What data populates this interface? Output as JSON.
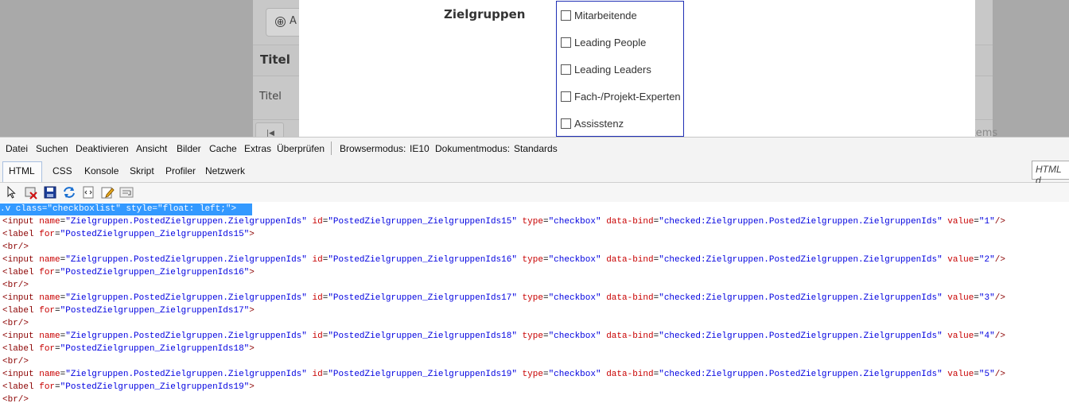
{
  "background": {
    "add_button_label": "A",
    "add_icon": "⊕",
    "table_header_title": "Titel",
    "row_title": "Titel",
    "pager_icon": "|◀",
    "items_label": "items"
  },
  "form": {
    "field_label": "Zielgruppen",
    "options": [
      {
        "label": "Mitarbeitende",
        "checked": false
      },
      {
        "label": "Leading People",
        "checked": false
      },
      {
        "label": "Leading Leaders",
        "checked": false
      },
      {
        "label": "Fach-/Projekt-Experten",
        "checked": false
      },
      {
        "label": "Assisstenz",
        "checked": false
      }
    ]
  },
  "devtools": {
    "menu": [
      "Datei",
      "Suchen",
      "Deaktivieren",
      "Ansicht",
      "Bilder",
      "Cache",
      "Extras",
      "Überprüfen"
    ],
    "browser_mode_label": "Browsermodus:",
    "browser_mode_value": "IE10",
    "document_mode_label": "Dokumentmodus:",
    "document_mode_value": "Standards",
    "tabs": [
      "HTML",
      "CSS",
      "Konsole",
      "Skript",
      "Profiler",
      "Netzwerk"
    ],
    "active_tab": "HTML",
    "search_placeholder": "HTML d",
    "toolbar_icons": [
      "select-element-icon",
      "clear-outline-icon",
      "save-icon",
      "refresh-icon",
      "view-source-icon",
      "edit-icon",
      "word-wrap-icon"
    ],
    "code": {
      "selected_line": ".v class=\"checkboxlist\" style=\"float: left;\">",
      "input_name": "Zielgruppen.PostedZielgruppen.ZielgruppenIds",
      "data_bind": "checked:Zielgruppen.PostedZielgruppen.ZielgruppenIds",
      "type": "checkbox",
      "rows": [
        {
          "id": "PostedZielgruppen_ZielgruppenIds15",
          "value": "1"
        },
        {
          "id": "PostedZielgruppen_ZielgruppenIds16",
          "value": "2"
        },
        {
          "id": "PostedZielgruppen_ZielgruppenIds17",
          "value": "3"
        },
        {
          "id": "PostedZielgruppen_ZielgruppenIds18",
          "value": "4"
        },
        {
          "id": "PostedZielgruppen_ZielgruppenIds19",
          "value": "5"
        }
      ]
    }
  },
  "colors": {
    "selection": "#3399ff",
    "tag": "#8b0000",
    "attribute": "#c80000",
    "string": "#0000e0",
    "checkbox_border": "#1f2fb5"
  }
}
